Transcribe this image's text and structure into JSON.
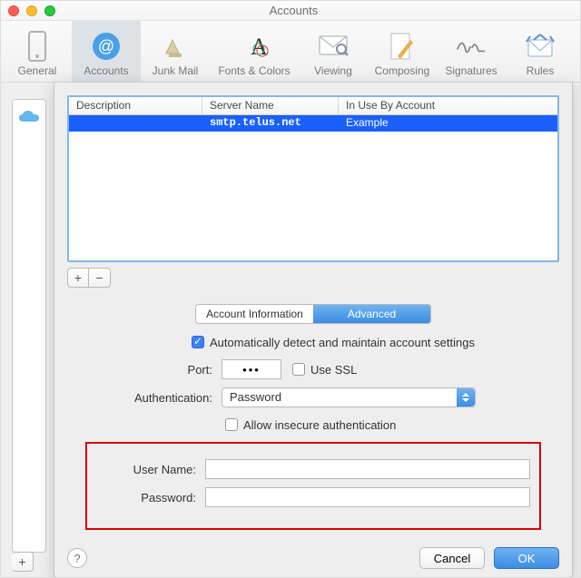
{
  "window": {
    "title": "Accounts"
  },
  "toolbar": {
    "items": [
      {
        "label": "General"
      },
      {
        "label": "Accounts"
      },
      {
        "label": "Junk Mail"
      },
      {
        "label": "Fonts & Colors"
      },
      {
        "label": "Viewing"
      },
      {
        "label": "Composing"
      },
      {
        "label": "Signatures"
      },
      {
        "label": "Rules"
      }
    ]
  },
  "table": {
    "headers": {
      "c1": "Description",
      "c2": "Server Name",
      "c3": "In Use By Account"
    },
    "rows": [
      {
        "description": "",
        "server": "smtp.telus.net",
        "account": "Example"
      }
    ]
  },
  "addrem": {
    "add": "+",
    "remove": "−"
  },
  "tabs": {
    "info": "Account Information",
    "advanced": "Advanced"
  },
  "form": {
    "autoDetect": "Automatically detect and maintain account settings",
    "portLabel": "Port:",
    "portValue": "•••",
    "useSsl": "Use SSL",
    "authLabel": "Authentication:",
    "authValue": "Password",
    "allowInsecure": "Allow insecure authentication",
    "userLabel": "User Name:",
    "userValue": "",
    "passLabel": "Password:",
    "passValue": ""
  },
  "buttons": {
    "cancel": "Cancel",
    "ok": "OK",
    "help": "?",
    "outerAdd": "+"
  }
}
